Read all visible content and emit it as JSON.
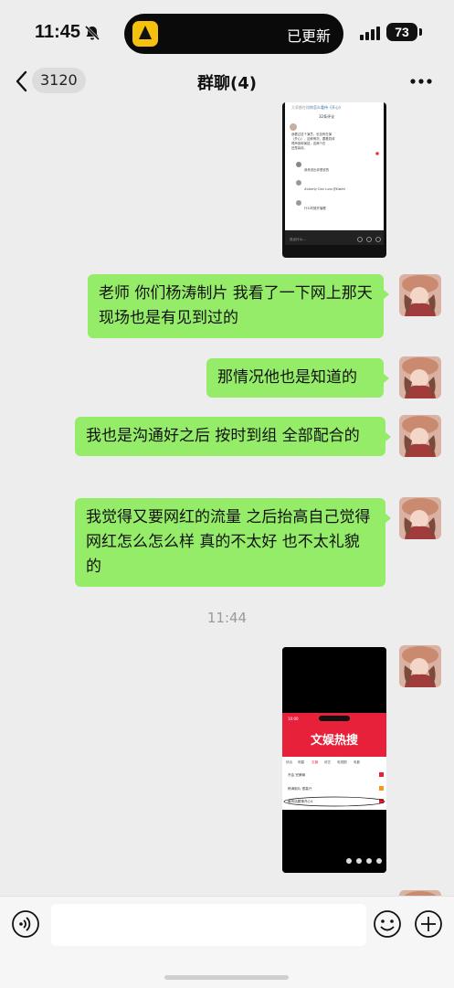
{
  "status_bar": {
    "time": "11:45",
    "island_text": "已更新",
    "battery": "73"
  },
  "nav": {
    "unread_count": "3120",
    "title": "群聊(4)"
  },
  "messages": [
    {
      "text": "老师 你们杨涛制片 我看了一下网上那天现场也是有见到过的"
    },
    {
      "text": "那情况他也是知道的"
    },
    {
      "text": "我也是沟通好之后 按时到组 全部配合的"
    },
    {
      "text": "我觉得又要网红的流量 之后抬高自己觉得网红怎么怎么样 真的不太好 也不太礼貌的"
    }
  ],
  "timestamp": "11:44",
  "screenshot_top": {
    "header": "大家都在搜",
    "search": "你怎么看待《开心》",
    "comments_label": "32条评论",
    "comment_lines": [
      "我看过这个演员，也没有在演",
      "《开心》，这种情况，要看具体",
      "得声音和演技，这两个在",
      "还是喜欢。"
    ],
    "user_1": "我来说出你想说的",
    "user_2": "#Liberty Clan Luna @Kiwimi",
    "user_3": "什么时候开播看",
    "input_hint": "说点什么..."
  },
  "screenshot_bottom": {
    "time": "10:00",
    "banner_text": "文娱热搜",
    "tabs": [
      "综合",
      "明星",
      "文娱",
      "综艺",
      "电视剧",
      "电影"
    ],
    "rows": [
      "开会 完美嘛",
      "杨涛制片 很高兴",
      "最有话题第开心4"
    ]
  },
  "colors": {
    "background": "#ededed",
    "bubble": "#95ec69",
    "timestamp": "#9a9a9a",
    "hot_search_red": "#e8213a"
  },
  "icons": [
    "bell-slash-icon",
    "signal-icon",
    "back-icon",
    "more-icon",
    "voice-icon",
    "emoji-icon",
    "plus-icon"
  ]
}
